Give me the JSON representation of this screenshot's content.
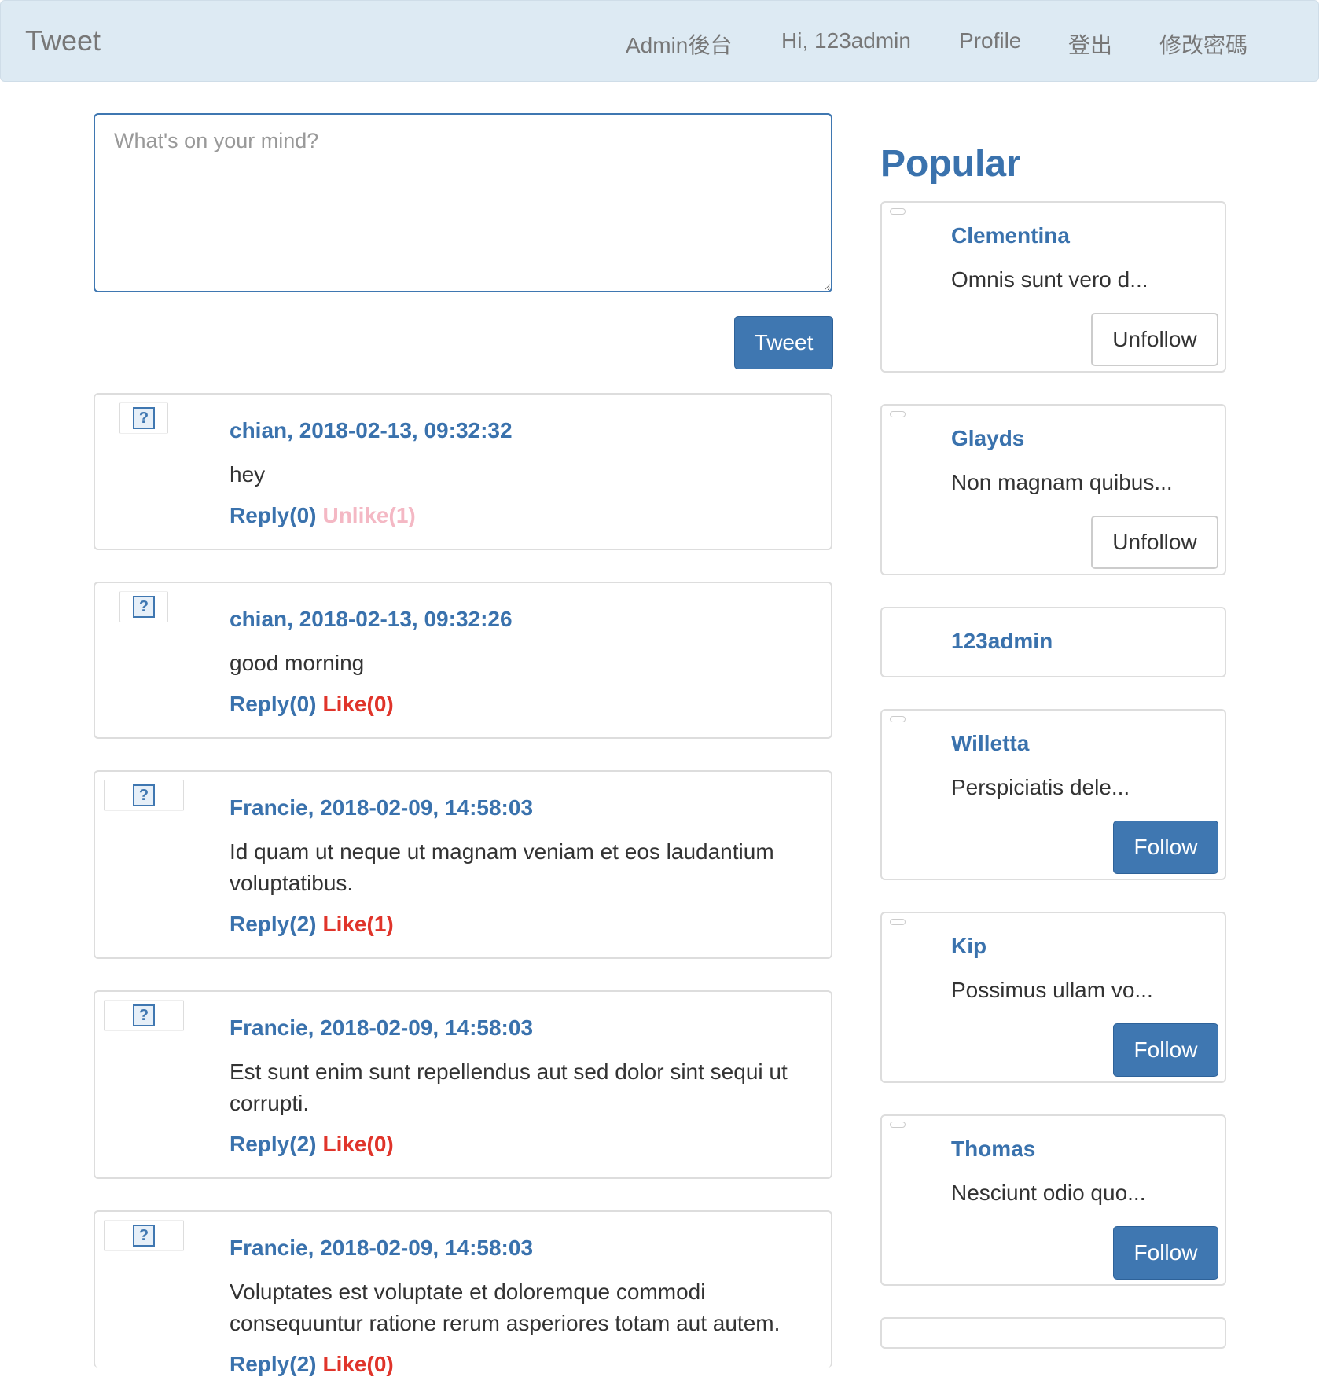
{
  "navbar": {
    "brand": "Tweet",
    "items": [
      {
        "label": "Admin後台"
      },
      {
        "label": "Hi, 123admin"
      },
      {
        "label": "Profile"
      },
      {
        "label": "登出"
      },
      {
        "label": "修改密碼"
      }
    ]
  },
  "composer": {
    "placeholder": "What's on your mind?",
    "submit_label": "Tweet"
  },
  "tweets": [
    {
      "header": "chian, 2018-02-13, 09:32:32",
      "text": "hey",
      "reply": "Reply(0)",
      "like": "Unlike(1)",
      "liked": true
    },
    {
      "header": "chian, 2018-02-13, 09:32:26",
      "text": "good morning",
      "reply": "Reply(0)",
      "like": "Like(0)",
      "liked": false
    },
    {
      "header": "Francie, 2018-02-09, 14:58:03",
      "text": "Id quam ut neque ut magnam veniam et eos laudantium voluptatibus.",
      "reply": "Reply(2)",
      "like": "Like(1)",
      "liked": false
    },
    {
      "header": "Francie, 2018-02-09, 14:58:03",
      "text": "Est sunt enim sunt repellendus aut sed dolor sint sequi ut corrupti.",
      "reply": "Reply(2)",
      "like": "Like(0)",
      "liked": false
    },
    {
      "header": "Francie, 2018-02-09, 14:58:03",
      "text": "Voluptates est voluptate et doloremque commodi consequuntur ratione rerum asperiores totam aut autem.",
      "reply": "Reply(2)",
      "like": "Like(0)",
      "liked": false
    }
  ],
  "popular": {
    "title": "Popular",
    "users": [
      {
        "name": "Clementina",
        "bio": "Omnis sunt vero d...",
        "button": "Unfollow",
        "following": true
      },
      {
        "name": "Glayds",
        "bio": "Non magnam quibus...",
        "button": "Unfollow",
        "following": true
      },
      {
        "name": "123admin",
        "bio": "",
        "button": "",
        "following": false
      },
      {
        "name": "Willetta",
        "bio": "Perspiciatis dele...",
        "button": "Follow",
        "following": false
      },
      {
        "name": "Kip",
        "bio": "Possimus ullam vo...",
        "button": "Follow",
        "following": false
      },
      {
        "name": "Thomas",
        "bio": "Nesciunt odio quo...",
        "button": "Follow",
        "following": false
      }
    ]
  },
  "colors": {
    "navbar_bg": "#ddeaf3",
    "primary": "#3f77b1",
    "link": "#3a72ad",
    "like": "#e0342a",
    "unlike": "#f4b8c4"
  }
}
